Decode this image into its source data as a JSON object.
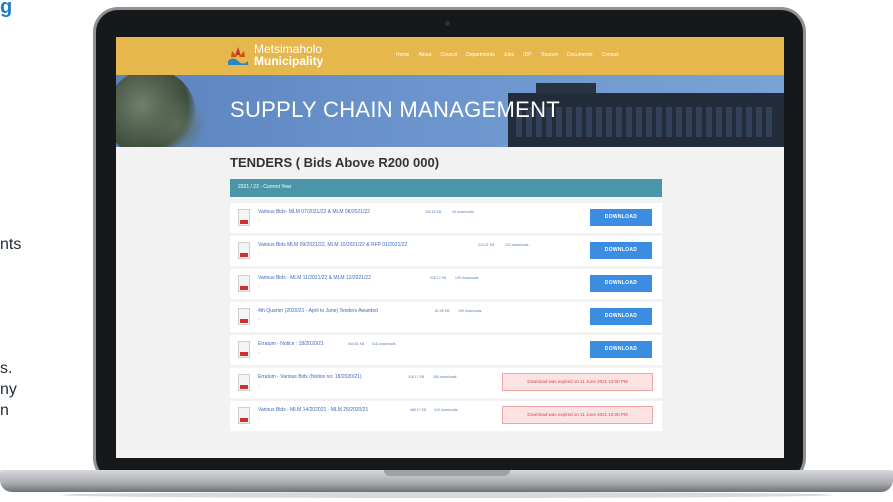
{
  "left_text": {
    "title": "g",
    "w1": "nts",
    "w2": "s.",
    "w3": "ny",
    "w4": "n"
  },
  "site": {
    "logo_line1": "Metsimaholo",
    "logo_line2": "Municipality",
    "nav": [
      "Home",
      "About",
      "Council",
      "Departments",
      "Jobs",
      "IDP",
      "Tourism",
      "Documents",
      "Contact"
    ],
    "hero_title": "SUPPLY CHAIN MANAGEMENT",
    "section_title": "TENDERS ( Bids Above R200 000)",
    "tab_label": "2021 / 22 - Current Year",
    "download_label": "DOWNLOAD",
    "rows": [
      {
        "title": "Various Bids- MLM 07/2021/22 & MLM 08/2021/22",
        "size": "254.52 KB",
        "downloads": "45 downloads",
        "dash": "-",
        "status": "download"
      },
      {
        "title": "Various Bids MLM 09/2021/22, MLM 10/2021/22 & RFP 01/2021/22",
        "size": "310.91 KB",
        "downloads": "102 downloads",
        "dash": "-",
        "status": "download"
      },
      {
        "title": "Various Bids - MLM 11/2021/22 & MLM 12/2021/22",
        "size": "228.17 KB",
        "downloads": "139 downloads",
        "dash": "-",
        "status": "download"
      },
      {
        "title": "4th Quarter (2020/21 - April to June) Tenders Awarded",
        "size": "82.95 KB",
        "downloads": "199 downloads",
        "dash": "-",
        "status": "download"
      },
      {
        "title": "Erratum - Notice : 18/2020/21",
        "size": "544.81 KB",
        "downloads": "618 downloads",
        "dash": "-",
        "status": "download"
      },
      {
        "title": "Erratum - Various Bids (Notice no: 18/2020/21)",
        "size": "316.17 KB",
        "downloads": "285 downloads",
        "dash": "-",
        "status": "expired",
        "expired_text": "Download was expired on 11 June 2021 10:00 PM"
      },
      {
        "title": "Various Bids - MLM 14/202021 - MLM 25/2020/21",
        "size": "488.17 KB",
        "downloads": "415 downloads",
        "dash": "-",
        "status": "expired",
        "expired_text": "Download was expired on 11 June 2021 10:00 PM"
      }
    ]
  },
  "colors": {
    "topbar": "#e6b74c",
    "tabbar": "#4a95a8",
    "button": "#3a8de0",
    "expired_text": "#d94848"
  }
}
